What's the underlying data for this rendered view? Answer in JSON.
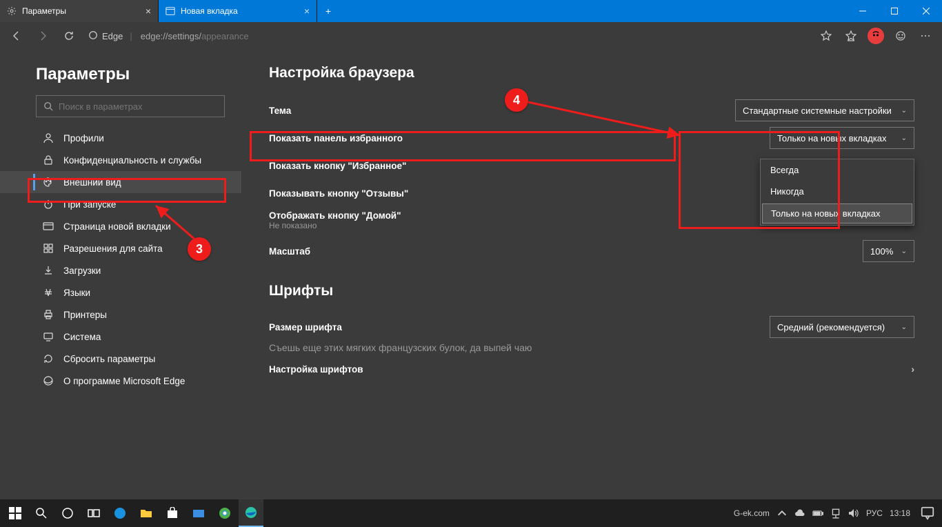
{
  "window": {
    "tabs": [
      {
        "title": "Параметры",
        "active": true
      },
      {
        "title": "Новая вкладка",
        "active": false
      }
    ]
  },
  "address": {
    "app_label": "Edge",
    "url_prefix": "edge://settings/",
    "url_path": "appearance"
  },
  "sidebar": {
    "title": "Параметры",
    "search_placeholder": "Поиск в параметрах",
    "items": [
      {
        "label": "Профили"
      },
      {
        "label": "Конфиденциальность и службы"
      },
      {
        "label": "Внешний вид"
      },
      {
        "label": "При запуске"
      },
      {
        "label": "Страница новой вкладки"
      },
      {
        "label": "Разрешения для сайта"
      },
      {
        "label": "Загрузки"
      },
      {
        "label": "Языки"
      },
      {
        "label": "Принтеры"
      },
      {
        "label": "Система"
      },
      {
        "label": "Сбросить параметры"
      },
      {
        "label": "О программе Microsoft Edge"
      }
    ]
  },
  "main": {
    "section1_title": "Настройка браузера",
    "theme_label": "Тема",
    "theme_value": "Стандартные системные настройки",
    "fav_panel_label": "Показать панель избранного",
    "fav_panel_value": "Только на новых вкладках",
    "fav_panel_options": [
      "Всегда",
      "Никогда",
      "Только на новых вкладках"
    ],
    "fav_button_label": "Показать кнопку \"Избранное\"",
    "feedback_label": "Показывать кнопку \"Отзывы\"",
    "home_label": "Отображать кнопку \"Домой\"",
    "home_sub": "Не показано",
    "zoom_label": "Масштаб",
    "zoom_value": "100%",
    "section2_title": "Шрифты",
    "font_size_label": "Размер шрифта",
    "font_size_value": "Средний (рекомендуется)",
    "font_sample": "Съешь еще этих мягких французских булок, да выпей чаю",
    "font_custom_label": "Настройка шрифтов"
  },
  "annotations": {
    "step3": "3",
    "step4": "4"
  },
  "taskbar": {
    "site": "G-ek.com",
    "lang": "РУС",
    "time": "13:18"
  }
}
